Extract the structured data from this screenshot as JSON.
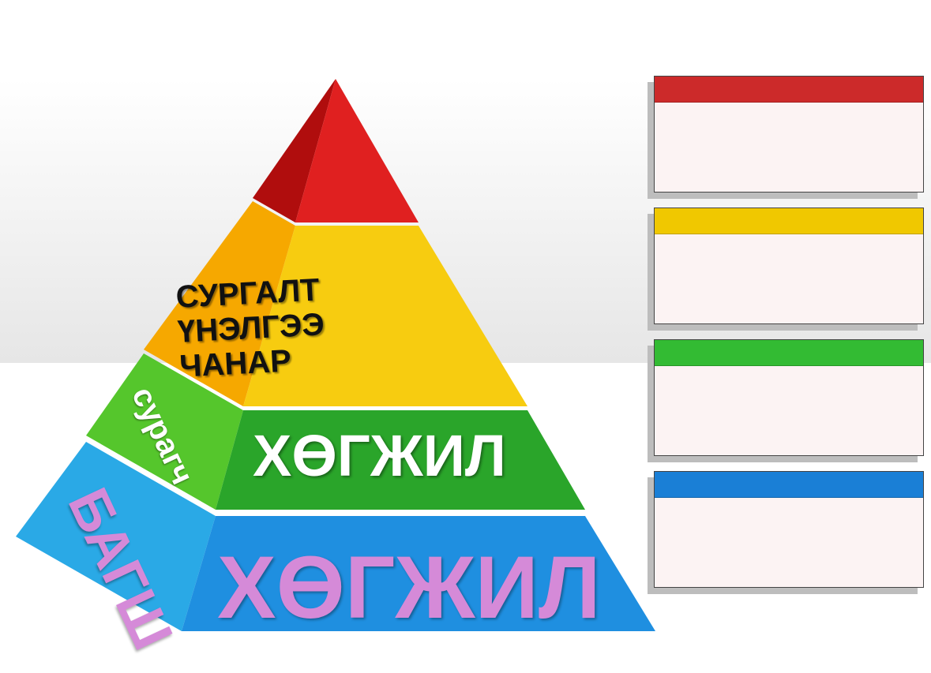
{
  "pyramid": {
    "top_lines": [
      "СУРГАЛТ",
      "ҮНЭЛГЭЭ",
      "ЧАНАР"
    ],
    "student_label": "сурагч",
    "student_development": "ХӨГЖИЛ",
    "teacher_label": "БАГШ",
    "teacher_development": "ХӨГЖИЛ"
  },
  "boxes": [
    {
      "color": "#cc2a2a"
    },
    {
      "color": "#f0c800"
    },
    {
      "color": "#33bb33"
    },
    {
      "color": "#1a7fd6"
    }
  ]
}
